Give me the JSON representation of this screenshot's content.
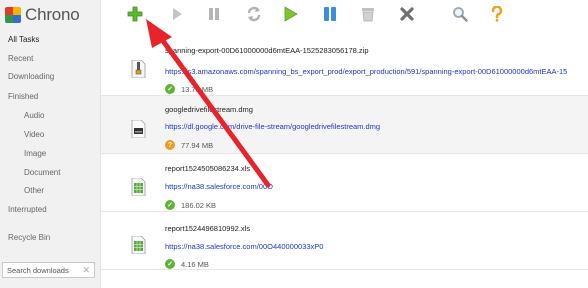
{
  "app": {
    "title": "Chrono"
  },
  "sidebar": {
    "items": [
      {
        "label": "All Tasks"
      },
      {
        "label": "Recent"
      },
      {
        "label": "Downloading"
      },
      {
        "label": "Finished"
      },
      {
        "label": "Audio"
      },
      {
        "label": "Video"
      },
      {
        "label": "Image"
      },
      {
        "label": "Document"
      },
      {
        "label": "Other"
      },
      {
        "label": "Interrupted"
      },
      {
        "label": "Recycle Bin"
      }
    ],
    "search": {
      "placeholder": "Search downloads",
      "clear_icon": "close-icon"
    }
  },
  "toolbar": {
    "buttons": [
      {
        "icon": "plus-icon",
        "color": "#5cb82f"
      },
      {
        "icon": "play-icon",
        "color": "#bdbdbd"
      },
      {
        "icon": "pause-icon",
        "color": "#b5b5b5"
      },
      {
        "icon": "refresh-icon",
        "color": "#b5b5b5"
      },
      {
        "icon": "play-all-icon",
        "color": "#7cc52c"
      },
      {
        "icon": "pause-all-icon",
        "color": "#3a8fdc"
      },
      {
        "icon": "trash-icon",
        "color": "#bdbdbd"
      },
      {
        "icon": "close-icon",
        "color": "#7a7a7a"
      },
      {
        "icon": "magnifier-icon",
        "color": "#9aa6b3"
      },
      {
        "icon": "help-icon",
        "color": "#f1a21d"
      }
    ]
  },
  "downloads": [
    {
      "name": "spanning-export-00D61000000d6mtEAA-1525283056178.zip",
      "url": "https://s3.amazonaws.com/spanning_bs_export_prod/export_production/591/spanning-export-00D61000000d6mtEAA-15",
      "size": "13.78 MB",
      "status": "complete",
      "file_icon": "zip-file-icon"
    },
    {
      "name": "googledrivefilestream.dmg",
      "url": "https://dl.google.com/drive-file-stream/googledrivefilestream.dmg",
      "size": "77.94 MB",
      "status": "unknown",
      "file_icon": "disk-image-file-icon"
    },
    {
      "name": "report1524505086234.xls",
      "url": "https://na38.salesforce.com/00O",
      "size": "186.02 KB",
      "status": "complete",
      "file_icon": "spreadsheet-file-icon"
    },
    {
      "name": "report1524496810992.xls",
      "url": "https://na38.salesforce.com/00O440000033xP0",
      "size": "4.16 MB",
      "status": "complete",
      "file_icon": "spreadsheet-file-icon"
    }
  ],
  "colors": {
    "accent_link": "#1a37c8",
    "annotation_arrow": "#e8232a",
    "success": "#5db431",
    "warning": "#f19a20"
  }
}
